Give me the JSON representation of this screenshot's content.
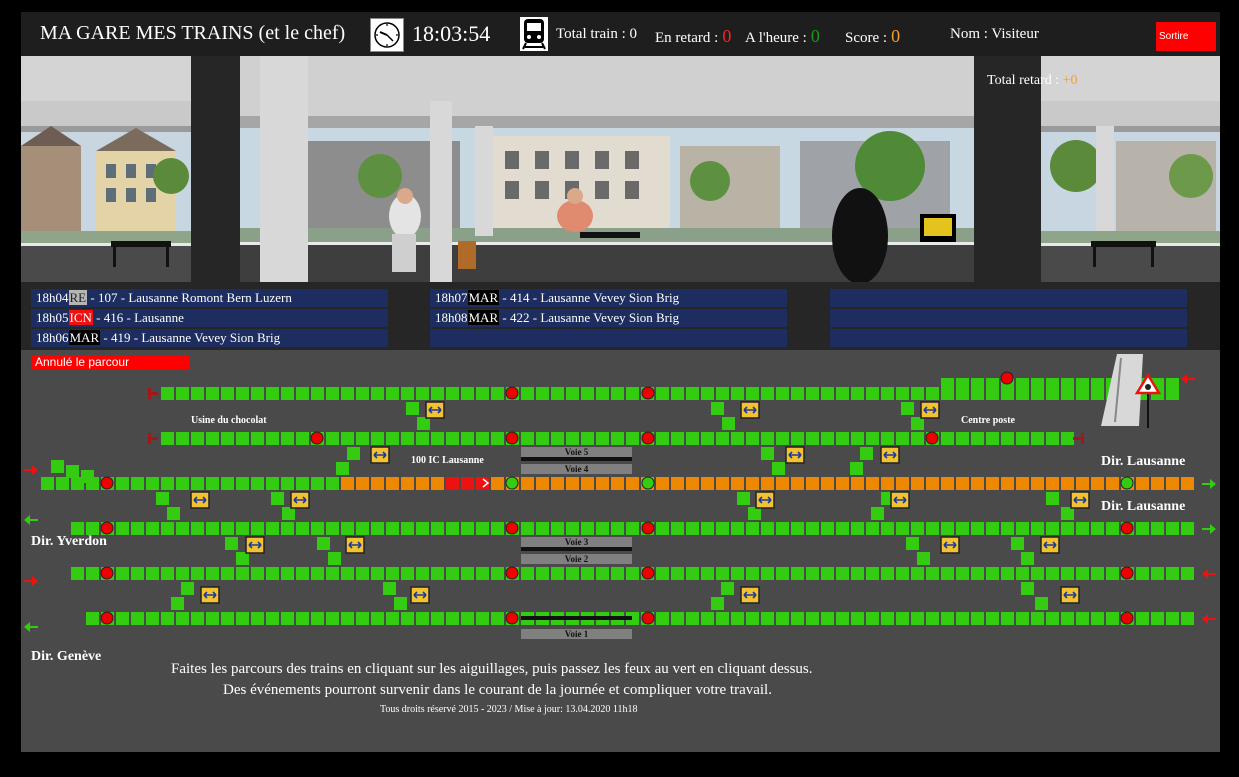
{
  "header": {
    "title": "MA GARE MES TRAINS (et le chef)",
    "time": "18:03:54",
    "total_label": "Total train :",
    "total_value": "0",
    "late_label": "En retard :",
    "late_value": "0",
    "ontime_label": "A l'heure :",
    "ontime_value": "0",
    "score_label": "Score :",
    "score_value": "0",
    "name_label": "Nom :",
    "name_value": "Visiteur",
    "exit_label": "Sortire",
    "colors": {
      "late": "#ff2020",
      "ontime": "#1a9a1a",
      "score": "#f2a030"
    }
  },
  "scene": {
    "total_delay_label": "Total retard :",
    "total_delay_value": "+0"
  },
  "departures": [
    {
      "time": "18h04",
      "category": "RE",
      "number": "107",
      "route": "Lausanne Romont Bern Luzern"
    },
    {
      "time": "18h05",
      "category": "ICN",
      "number": "416",
      "route": "Lausanne"
    },
    {
      "time": "18h06",
      "category": "MAR",
      "number": "419",
      "route": "Lausanne Vevey Sion Brig"
    },
    {
      "time": "18h07",
      "category": "MAR",
      "number": "414",
      "route": "Lausanne Vevey Sion Brig"
    },
    {
      "time": "18h08",
      "category": "MAR",
      "number": "422",
      "route": "Lausanne Vevey Sion Brig"
    }
  ],
  "tracks": {
    "cancel_label": "Annulé le parcour",
    "labels": {
      "usine": "Usine du chocolat",
      "centre": "Centre poste",
      "train": "100 IC Lausanne",
      "dir_lausanne_1": "Dir. Lausanne",
      "dir_lausanne_2": "Dir. Lausanne",
      "dir_yverdon": "Dir. Yverdon",
      "dir_geneve": "Dir. Genève"
    },
    "voies": {
      "v5": "Voie 5",
      "v4": "Voie 4",
      "v3": "Voie 3",
      "v2": "Voie 2",
      "v1": "Voie 1"
    },
    "colors": {
      "free": "#33cc11",
      "occupied": "#ee8800",
      "signal_red": "#ee0000",
      "signal_green": "#33cc11",
      "train": "#ee1111",
      "switch": "#f2c230"
    }
  },
  "footer": {
    "line1": "Faites les parcours des trains en cliquant sur les aiguillages, puis passez les feux au vert en cliquant dessus.",
    "line2": "Des événements pourront survenir dans le courant de la journée et compliquer votre travail.",
    "copyright": "Tous droits réservé 2015 - 2023 / Mise à jour: 13.04.2020 11h18"
  }
}
